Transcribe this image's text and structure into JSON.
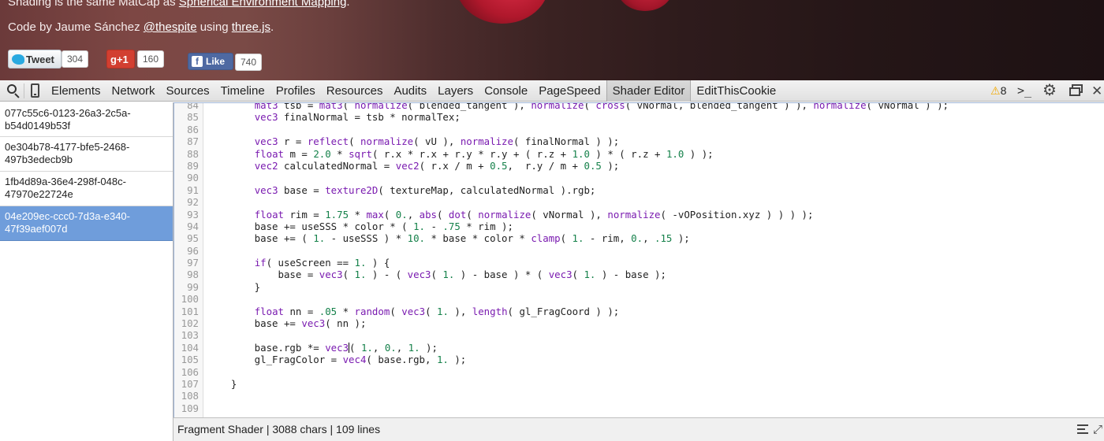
{
  "webpage": {
    "line1_prefix": "Shading is the same MatCap as ",
    "line1_link": "Spherical Environment Mapping",
    "line1_suffix": ".",
    "line2_prefix": "Code by Jaume Sánchez ",
    "line2_link1": "@thespite",
    "line2_mid": " using ",
    "line2_link2": "three.js",
    "line2_suffix": ".",
    "social": {
      "tweet_label": "Tweet",
      "tweet_count": "304",
      "gplus_label": "g+1",
      "gplus_count": "160",
      "fb_label": "Like",
      "fb_count": "740"
    }
  },
  "toolbar": {
    "tabs": [
      "Elements",
      "Network",
      "Sources",
      "Timeline",
      "Profiles",
      "Resources",
      "Audits",
      "Layers",
      "Console",
      "PageSpeed",
      "Shader Editor",
      "EditThisCookie"
    ],
    "selected_tab": "Shader Editor",
    "warnings_count": "8",
    "icons": [
      "search-icon",
      "device-mode-icon",
      "warning-icon",
      "console-drawer-icon",
      "gear-icon",
      "dock-icon",
      "close-icon"
    ]
  },
  "sidebar": {
    "items": [
      {
        "label": "077c55c6-0123-26a3-2c5a-\nb54d0149b53f",
        "selected": false
      },
      {
        "label": "0e304b78-4177-bfe5-2468-\n497b3edecb9b",
        "selected": false
      },
      {
        "label": "1fb4d89a-36e4-298f-048c-\n47970e22724e",
        "selected": false
      },
      {
        "label": "04e209ec-ccc0-7d3a-e340-\n47f39aef007d",
        "selected": true
      }
    ]
  },
  "editor": {
    "lines": [
      {
        "n": "84",
        "code": "        mat3 tsb = mat3( normalize( blended_tangent ), normalize( cross( vNormal, blended_tangent ) ), normalize( vNormal ) );"
      },
      {
        "n": "85",
        "code": "        vec3 finalNormal = tsb * normalTex;"
      },
      {
        "n": "86",
        "code": ""
      },
      {
        "n": "87",
        "code": "        vec3 r = reflect( normalize( vU ), normalize( finalNormal ) );"
      },
      {
        "n": "88",
        "code": "        float m = 2.0 * sqrt( r.x * r.x + r.y * r.y + ( r.z + 1.0 ) * ( r.z + 1.0 ) );"
      },
      {
        "n": "89",
        "code": "        vec2 calculatedNormal = vec2( r.x / m + 0.5,  r.y / m + 0.5 );"
      },
      {
        "n": "90",
        "code": ""
      },
      {
        "n": "91",
        "code": "        vec3 base = texture2D( textureMap, calculatedNormal ).rgb;"
      },
      {
        "n": "92",
        "code": ""
      },
      {
        "n": "93",
        "code": "        float rim = 1.75 * max( 0., abs( dot( normalize( vNormal ), normalize( -vOPosition.xyz ) ) ) );"
      },
      {
        "n": "94",
        "code": "        base += useSSS * color * ( 1. - .75 * rim );"
      },
      {
        "n": "95",
        "code": "        base += ( 1. - useSSS ) * 10. * base * color * clamp( 1. - rim, 0., .15 );"
      },
      {
        "n": "96",
        "code": ""
      },
      {
        "n": "97",
        "code": "        if( useScreen == 1. ) {"
      },
      {
        "n": "98",
        "code": "            base = vec3( 1. ) - ( vec3( 1. ) - base ) * ( vec3( 1. ) - base );"
      },
      {
        "n": "99",
        "code": "        }"
      },
      {
        "n": "100",
        "code": ""
      },
      {
        "n": "101",
        "code": "        float nn = .05 * random( vec3( 1. ), length( gl_FragCoord ) );"
      },
      {
        "n": "102",
        "code": "        base += vec3( nn );"
      },
      {
        "n": "103",
        "code": ""
      },
      {
        "n": "104",
        "code": "        base.rgb *= vec3( 1., 0., 1. );"
      },
      {
        "n": "105",
        "code": "        gl_FragColor = vec4( base.rgb, 1. );"
      },
      {
        "n": "106",
        "code": ""
      },
      {
        "n": "107",
        "code": "    }"
      },
      {
        "n": "108",
        "code": ""
      },
      {
        "n": "109",
        "code": ""
      }
    ],
    "cursor_line": "104"
  },
  "status": {
    "text": "Fragment Shader | 3088 chars | 109 lines"
  },
  "colors": {
    "keyword": "#7a1bb0",
    "number": "#15814a",
    "selection": "#6f9ddb"
  }
}
